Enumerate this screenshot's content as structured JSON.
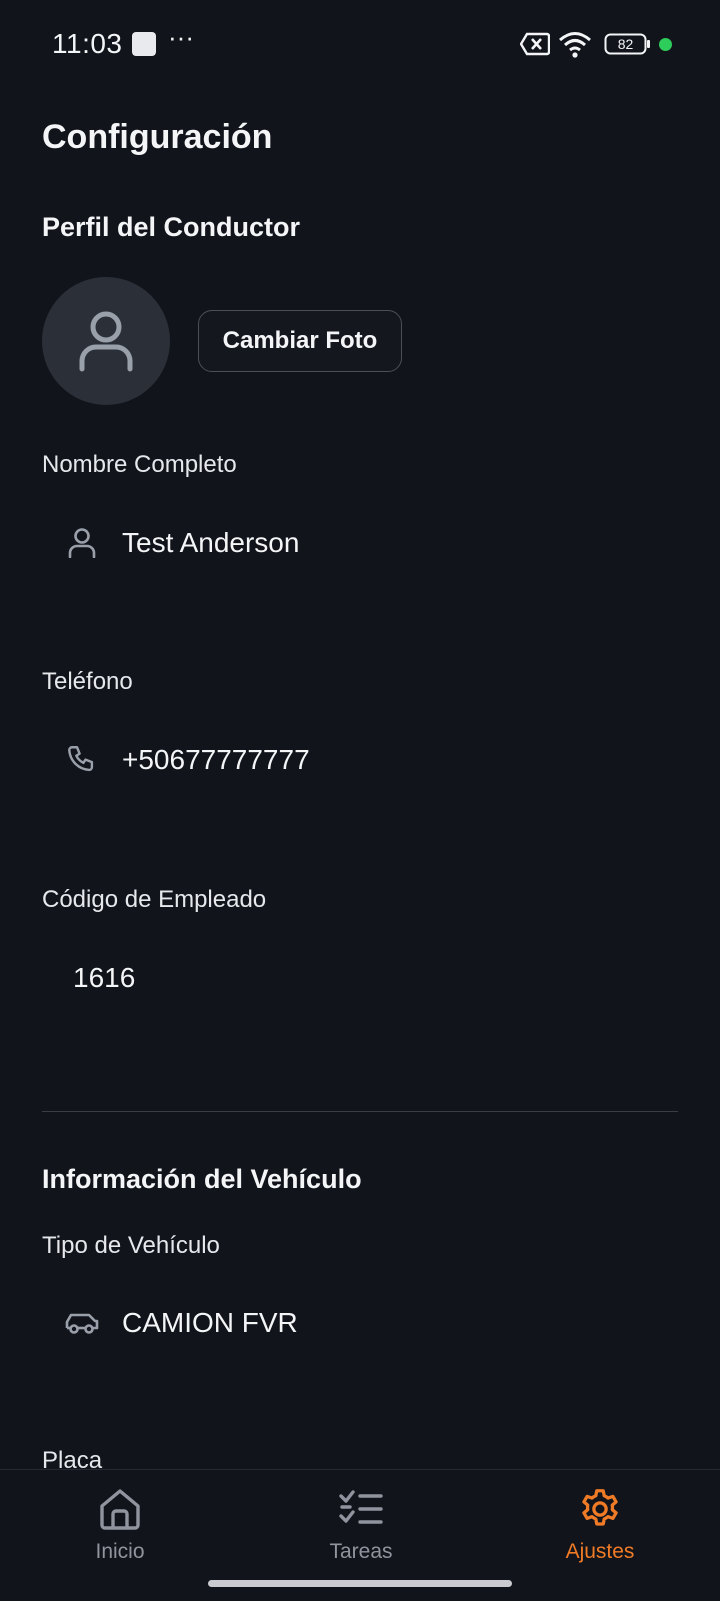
{
  "status_bar": {
    "time": "11:03",
    "more": "···",
    "battery": "82"
  },
  "page": {
    "title": "Configuración"
  },
  "driver_profile": {
    "section_title": "Perfil del Conductor",
    "change_photo_label": "Cambiar Foto",
    "fields": [
      {
        "label": "Nombre Completo",
        "value": "Test Anderson",
        "icon": "user-icon"
      },
      {
        "label": "Teléfono",
        "value": "+50677777777",
        "icon": "phone-icon"
      },
      {
        "label": "Código de Empleado",
        "value": "1616",
        "icon": ""
      }
    ]
  },
  "vehicle_info": {
    "section_title": "Información del Vehículo",
    "fields": [
      {
        "label": "Tipo de Vehículo",
        "value": "CAMION FVR",
        "icon": "car-icon"
      },
      {
        "label": "Placa",
        "value": ""
      }
    ]
  },
  "bottom_nav": {
    "items": [
      {
        "label": "Inicio",
        "icon": "home-icon",
        "active": false
      },
      {
        "label": "Tareas",
        "icon": "task-list-icon",
        "active": false
      },
      {
        "label": "Ajustes",
        "icon": "settings-gear-icon",
        "active": true
      }
    ]
  },
  "colors": {
    "background": "#11141b",
    "accent": "#f07b26",
    "muted": "#8f949e"
  }
}
